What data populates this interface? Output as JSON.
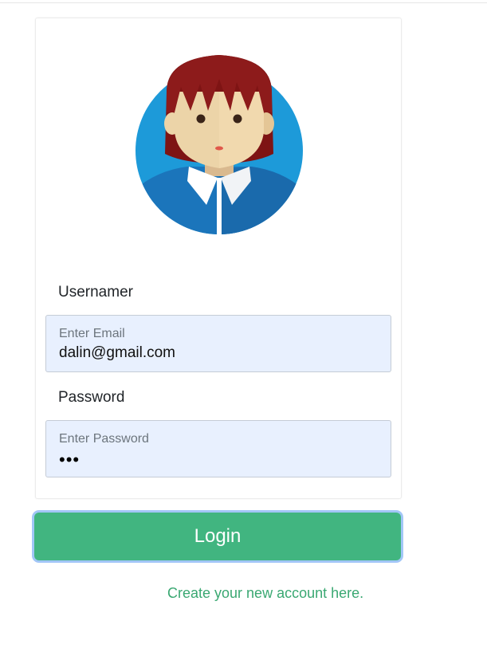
{
  "form": {
    "username_label": "Usernamer",
    "email_placeholder": "Enter Email",
    "email_value": "dalin@gmail.com",
    "password_label": "Password",
    "password_placeholder": "Enter Password",
    "password_mask": "•••"
  },
  "actions": {
    "login_label": "Login",
    "create_account_link": "Create your new account here."
  },
  "colors": {
    "login_button": "#41b580",
    "link": "#3aa872",
    "input_background": "#e8f0fe",
    "avatar_circle": "#1d9ad9",
    "avatar_hair": "#8d1b1b"
  },
  "icons": {
    "avatar": "female-user-avatar"
  }
}
